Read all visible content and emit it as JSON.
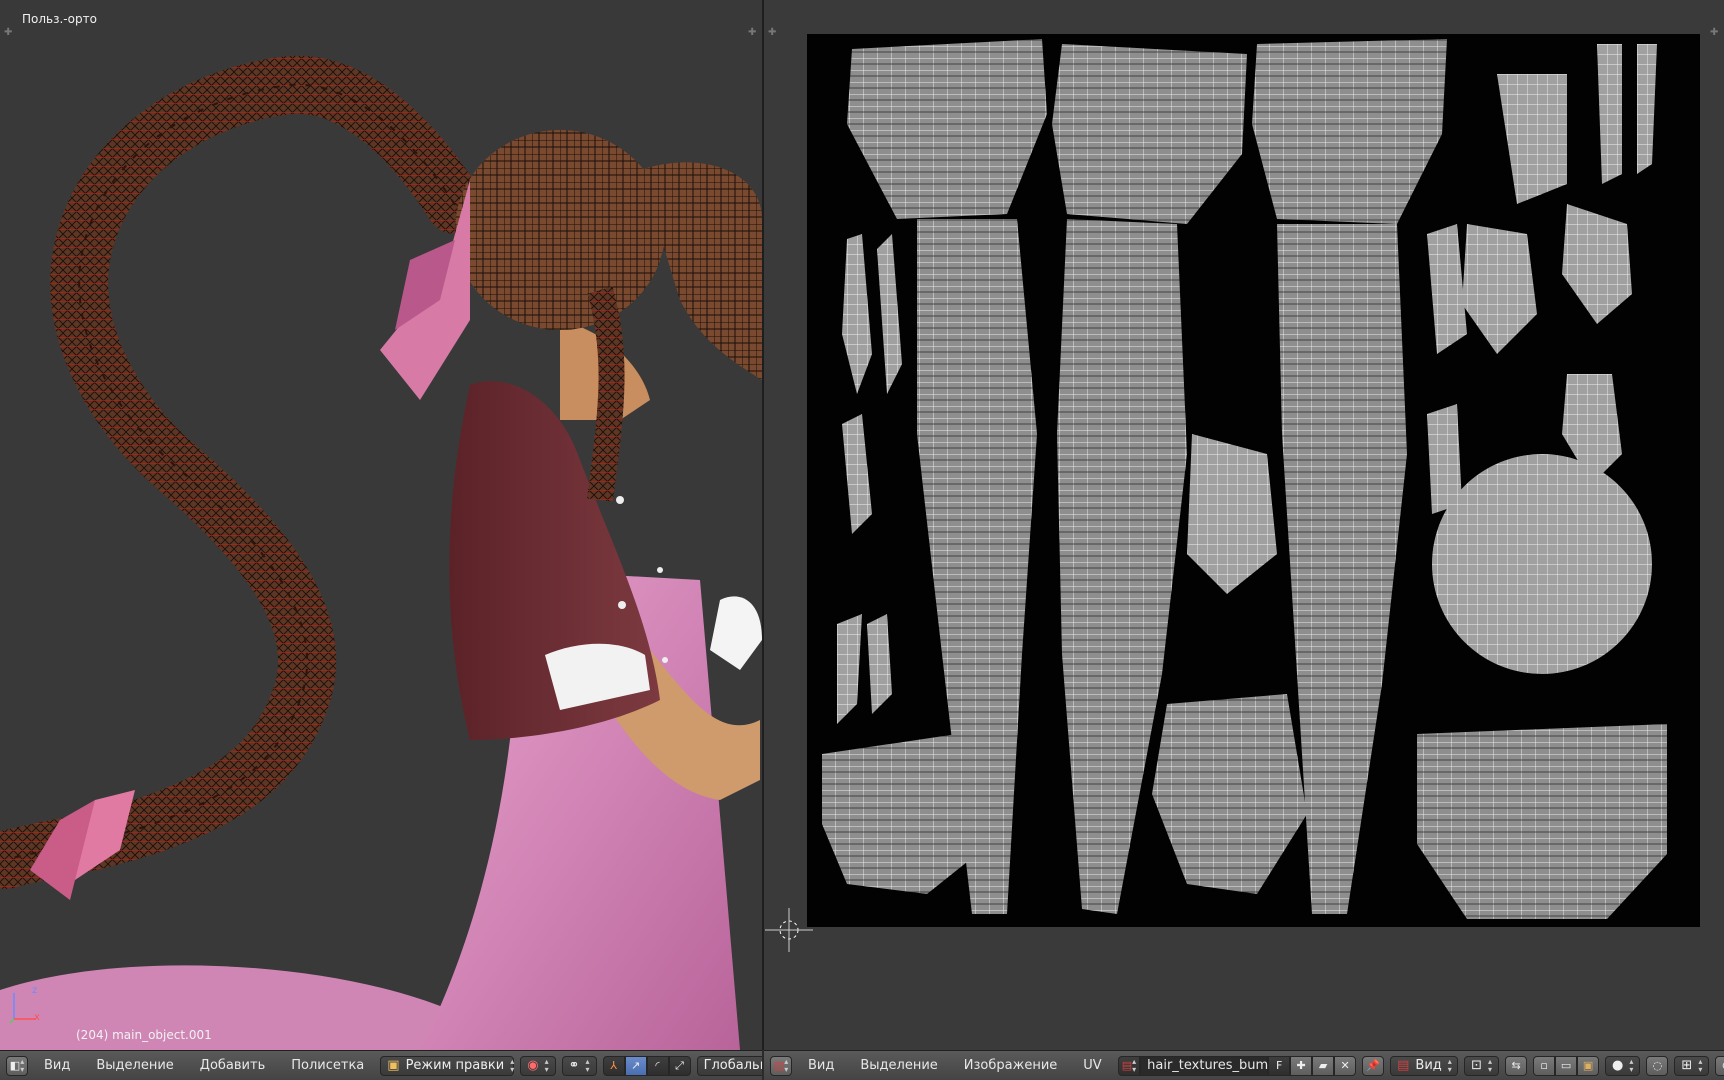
{
  "view3d": {
    "title": "Польз.-орто",
    "object_label": "(204) main_object.001",
    "axes": {
      "x": "x",
      "z": "z"
    },
    "header": {
      "menus": [
        "Вид",
        "Выделение",
        "Добавить",
        "Полисетка"
      ],
      "mode": "Режим правки",
      "orientation": "Глобально",
      "editor_icon": "3d-view-icon",
      "shading_icon": "viewport-shading-icon",
      "pivot_icon": "pivot-point-icon"
    }
  },
  "uv_editor": {
    "header": {
      "menus": [
        "Вид",
        "Выделение",
        "Изображение",
        "UV"
      ],
      "image_name": "hair_textures_bump...",
      "fake_user": "F",
      "view_mode": "Вид",
      "editor_icon": "image-editor-icon"
    }
  },
  "colors": {
    "viewport_bg": "#393939",
    "header_bg": "#4f4f4f",
    "uv_wire": "#e8e8e8",
    "hair": "#5a3422",
    "jacket": "#6e2d33",
    "dress": "#d98bb8",
    "active_button": "#5a7cc0"
  }
}
